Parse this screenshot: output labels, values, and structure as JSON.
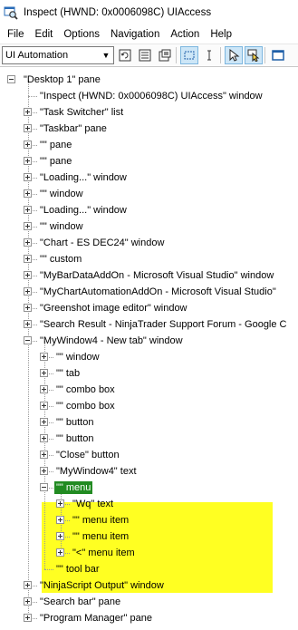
{
  "window": {
    "title": "Inspect  (HWND: 0x0006098C) UIAccess",
    "icon": "magnifier-icon"
  },
  "menubar": [
    "File",
    "Edit",
    "Options",
    "Navigation",
    "Action",
    "Help"
  ],
  "toolbar": {
    "mode_value": "UI Automation",
    "buttons": [
      "refresh-icon",
      "view-list-icon",
      "view-properties-icon",
      "highlight-rect-icon",
      "caret-icon",
      "pointer-icon",
      "focus-pointer-icon",
      "window-icon"
    ]
  },
  "highlight_color": "#ffff22",
  "selected_color": "#228b22",
  "tree": [
    {
      "label": "\"Desktop 1\" pane",
      "level": 0,
      "expander": "minus"
    },
    {
      "label": "\"Inspect  (HWND: 0x0006098C) UIAccess\" window",
      "level": 1,
      "expander": "none"
    },
    {
      "label": "\"Task Switcher\" list",
      "level": 1,
      "expander": "plus"
    },
    {
      "label": "\"Taskbar\" pane",
      "level": 1,
      "expander": "plus"
    },
    {
      "label": "\"\" pane",
      "level": 1,
      "expander": "plus"
    },
    {
      "label": "\"\" pane",
      "level": 1,
      "expander": "plus"
    },
    {
      "label": "\"Loading...\" window",
      "level": 1,
      "expander": "plus"
    },
    {
      "label": "\"\" window",
      "level": 1,
      "expander": "plus"
    },
    {
      "label": "\"Loading...\" window",
      "level": 1,
      "expander": "plus"
    },
    {
      "label": "\"\" window",
      "level": 1,
      "expander": "plus"
    },
    {
      "label": "\"Chart - ES DEC24\" window",
      "level": 1,
      "expander": "plus"
    },
    {
      "label": "\"\" custom",
      "level": 1,
      "expander": "plus"
    },
    {
      "label": "\"MyBarDataAddOn - Microsoft Visual Studio\" window",
      "level": 1,
      "expander": "plus"
    },
    {
      "label": "\"MyChartAutomationAddOn - Microsoft Visual Studio\"",
      "level": 1,
      "expander": "plus"
    },
    {
      "label": "\"Greenshot image editor\" window",
      "level": 1,
      "expander": "plus"
    },
    {
      "label": "\"Search Result - NinjaTrader Support Forum - Google C",
      "level": 1,
      "expander": "plus"
    },
    {
      "label": "\"MyWindow4 - New tab\" window",
      "level": 1,
      "expander": "minus"
    },
    {
      "label": "\"\" window",
      "level": 2,
      "expander": "plus"
    },
    {
      "label": "\"\" tab",
      "level": 2,
      "expander": "plus"
    },
    {
      "label": "\"\" combo box",
      "level": 2,
      "expander": "plus"
    },
    {
      "label": "\"\" combo box",
      "level": 2,
      "expander": "plus"
    },
    {
      "label": "\"\" button",
      "level": 2,
      "expander": "plus"
    },
    {
      "label": "\"\" button",
      "level": 2,
      "expander": "plus"
    },
    {
      "label": "\"Close\" button",
      "level": 2,
      "expander": "plus"
    },
    {
      "label": "\"MyWindow4\" text",
      "level": 2,
      "expander": "plus"
    },
    {
      "label": "\"\" menu",
      "level": 2,
      "expander": "minus",
      "selected": true
    },
    {
      "label": "\"Wq\" text",
      "level": 3,
      "expander": "plus"
    },
    {
      "label": "\"\" menu item",
      "level": 3,
      "expander": "plus"
    },
    {
      "label": "\"\" menu item",
      "level": 3,
      "expander": "plus"
    },
    {
      "label": "\"<\" menu item",
      "level": 3,
      "expander": "plus"
    },
    {
      "label": "\"\" tool bar",
      "level": 2,
      "expander": "none"
    },
    {
      "label": "\"NinjaScript Output\" window",
      "level": 1,
      "expander": "plus"
    },
    {
      "label": "\"Search bar\" pane",
      "level": 1,
      "expander": "plus"
    },
    {
      "label": "\"Program Manager\" pane",
      "level": 1,
      "expander": "plus"
    }
  ]
}
